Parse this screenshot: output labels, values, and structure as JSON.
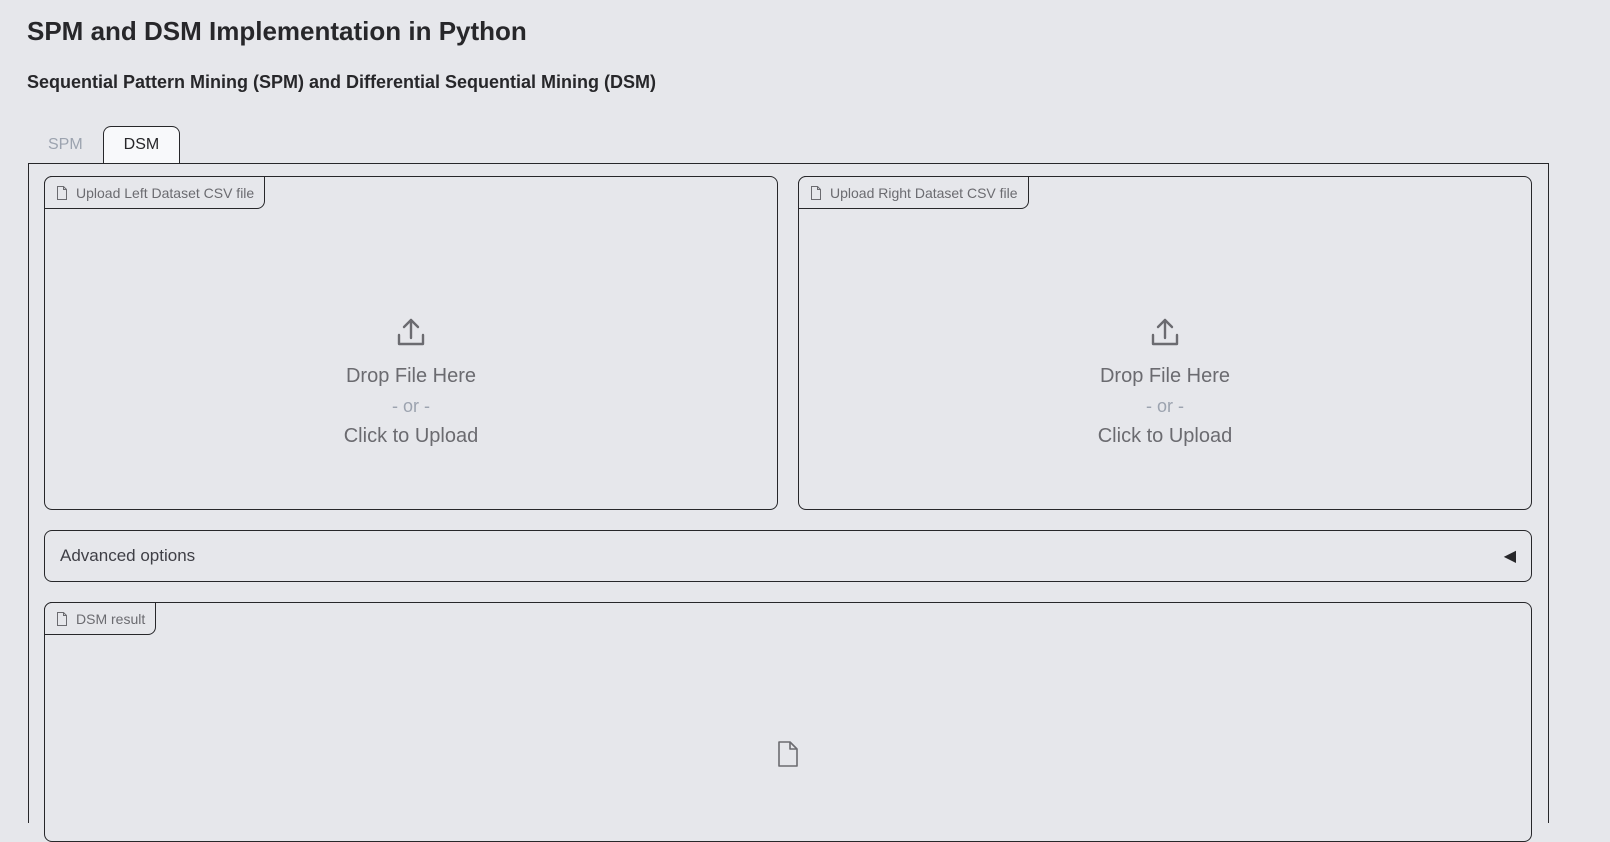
{
  "header": {
    "title": "SPM and DSM Implementation in Python",
    "subtitle": "Sequential Pattern Mining (SPM) and Differential Sequential Mining (DSM)"
  },
  "tabs": [
    {
      "label": "SPM",
      "selected": false
    },
    {
      "label": "DSM",
      "selected": true
    }
  ],
  "dsm": {
    "left_upload": {
      "label": "Upload Left Dataset CSV file",
      "icon": "file-icon",
      "drop_text": "Drop File Here",
      "or_text": "- or -",
      "click_text": "Click to Upload"
    },
    "right_upload": {
      "label": "Upload Right Dataset CSV file",
      "icon": "file-icon",
      "drop_text": "Drop File Here",
      "or_text": "- or -",
      "click_text": "Click to Upload"
    },
    "advanced": {
      "label": "Advanced options",
      "arrow": "◀"
    },
    "result": {
      "label": "DSM result",
      "icon": "file-icon"
    }
  },
  "colors": {
    "background": "#e6e7eb",
    "border": "#27272a",
    "muted_text": "#6b6b70",
    "inactive_tab": "#9ca3af"
  }
}
